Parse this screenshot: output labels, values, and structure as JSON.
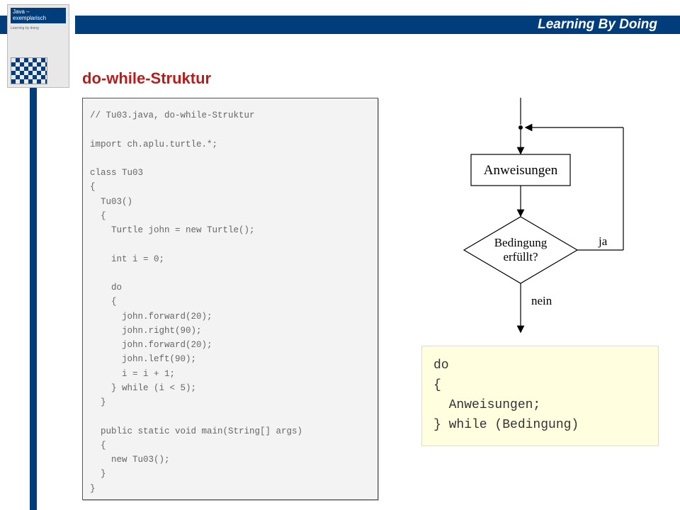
{
  "header": {
    "title": "Learning By Doing"
  },
  "book": {
    "title_line1": "Java –",
    "title_line2": "exemplarisch",
    "sub": "Learning by doing"
  },
  "section": {
    "title": "do-while-Struktur"
  },
  "code": "// Tu03.java, do-while-Struktur\n\nimport ch.aplu.turtle.*;\n\nclass Tu03\n{\n  Tu03()\n  {\n    Turtle john = new Turtle();\n\n    int i = 0;\n\n    do\n    {\n      john.forward(20);\n      john.right(90);\n      john.forward(20);\n      john.left(90);\n      i = i + 1;\n    } while (i < 5);\n  }\n\n  public static void main(String[] args)\n  {\n    new Tu03();\n  }\n}",
  "flowchart": {
    "box_label": "Anweisungen",
    "diamond_line1": "Bedingung",
    "diamond_line2": "erfüllt?",
    "yes_label": "ja",
    "no_label": "nein"
  },
  "syntax": "do\n{\n  Anweisungen;\n} while (Bedingung)"
}
